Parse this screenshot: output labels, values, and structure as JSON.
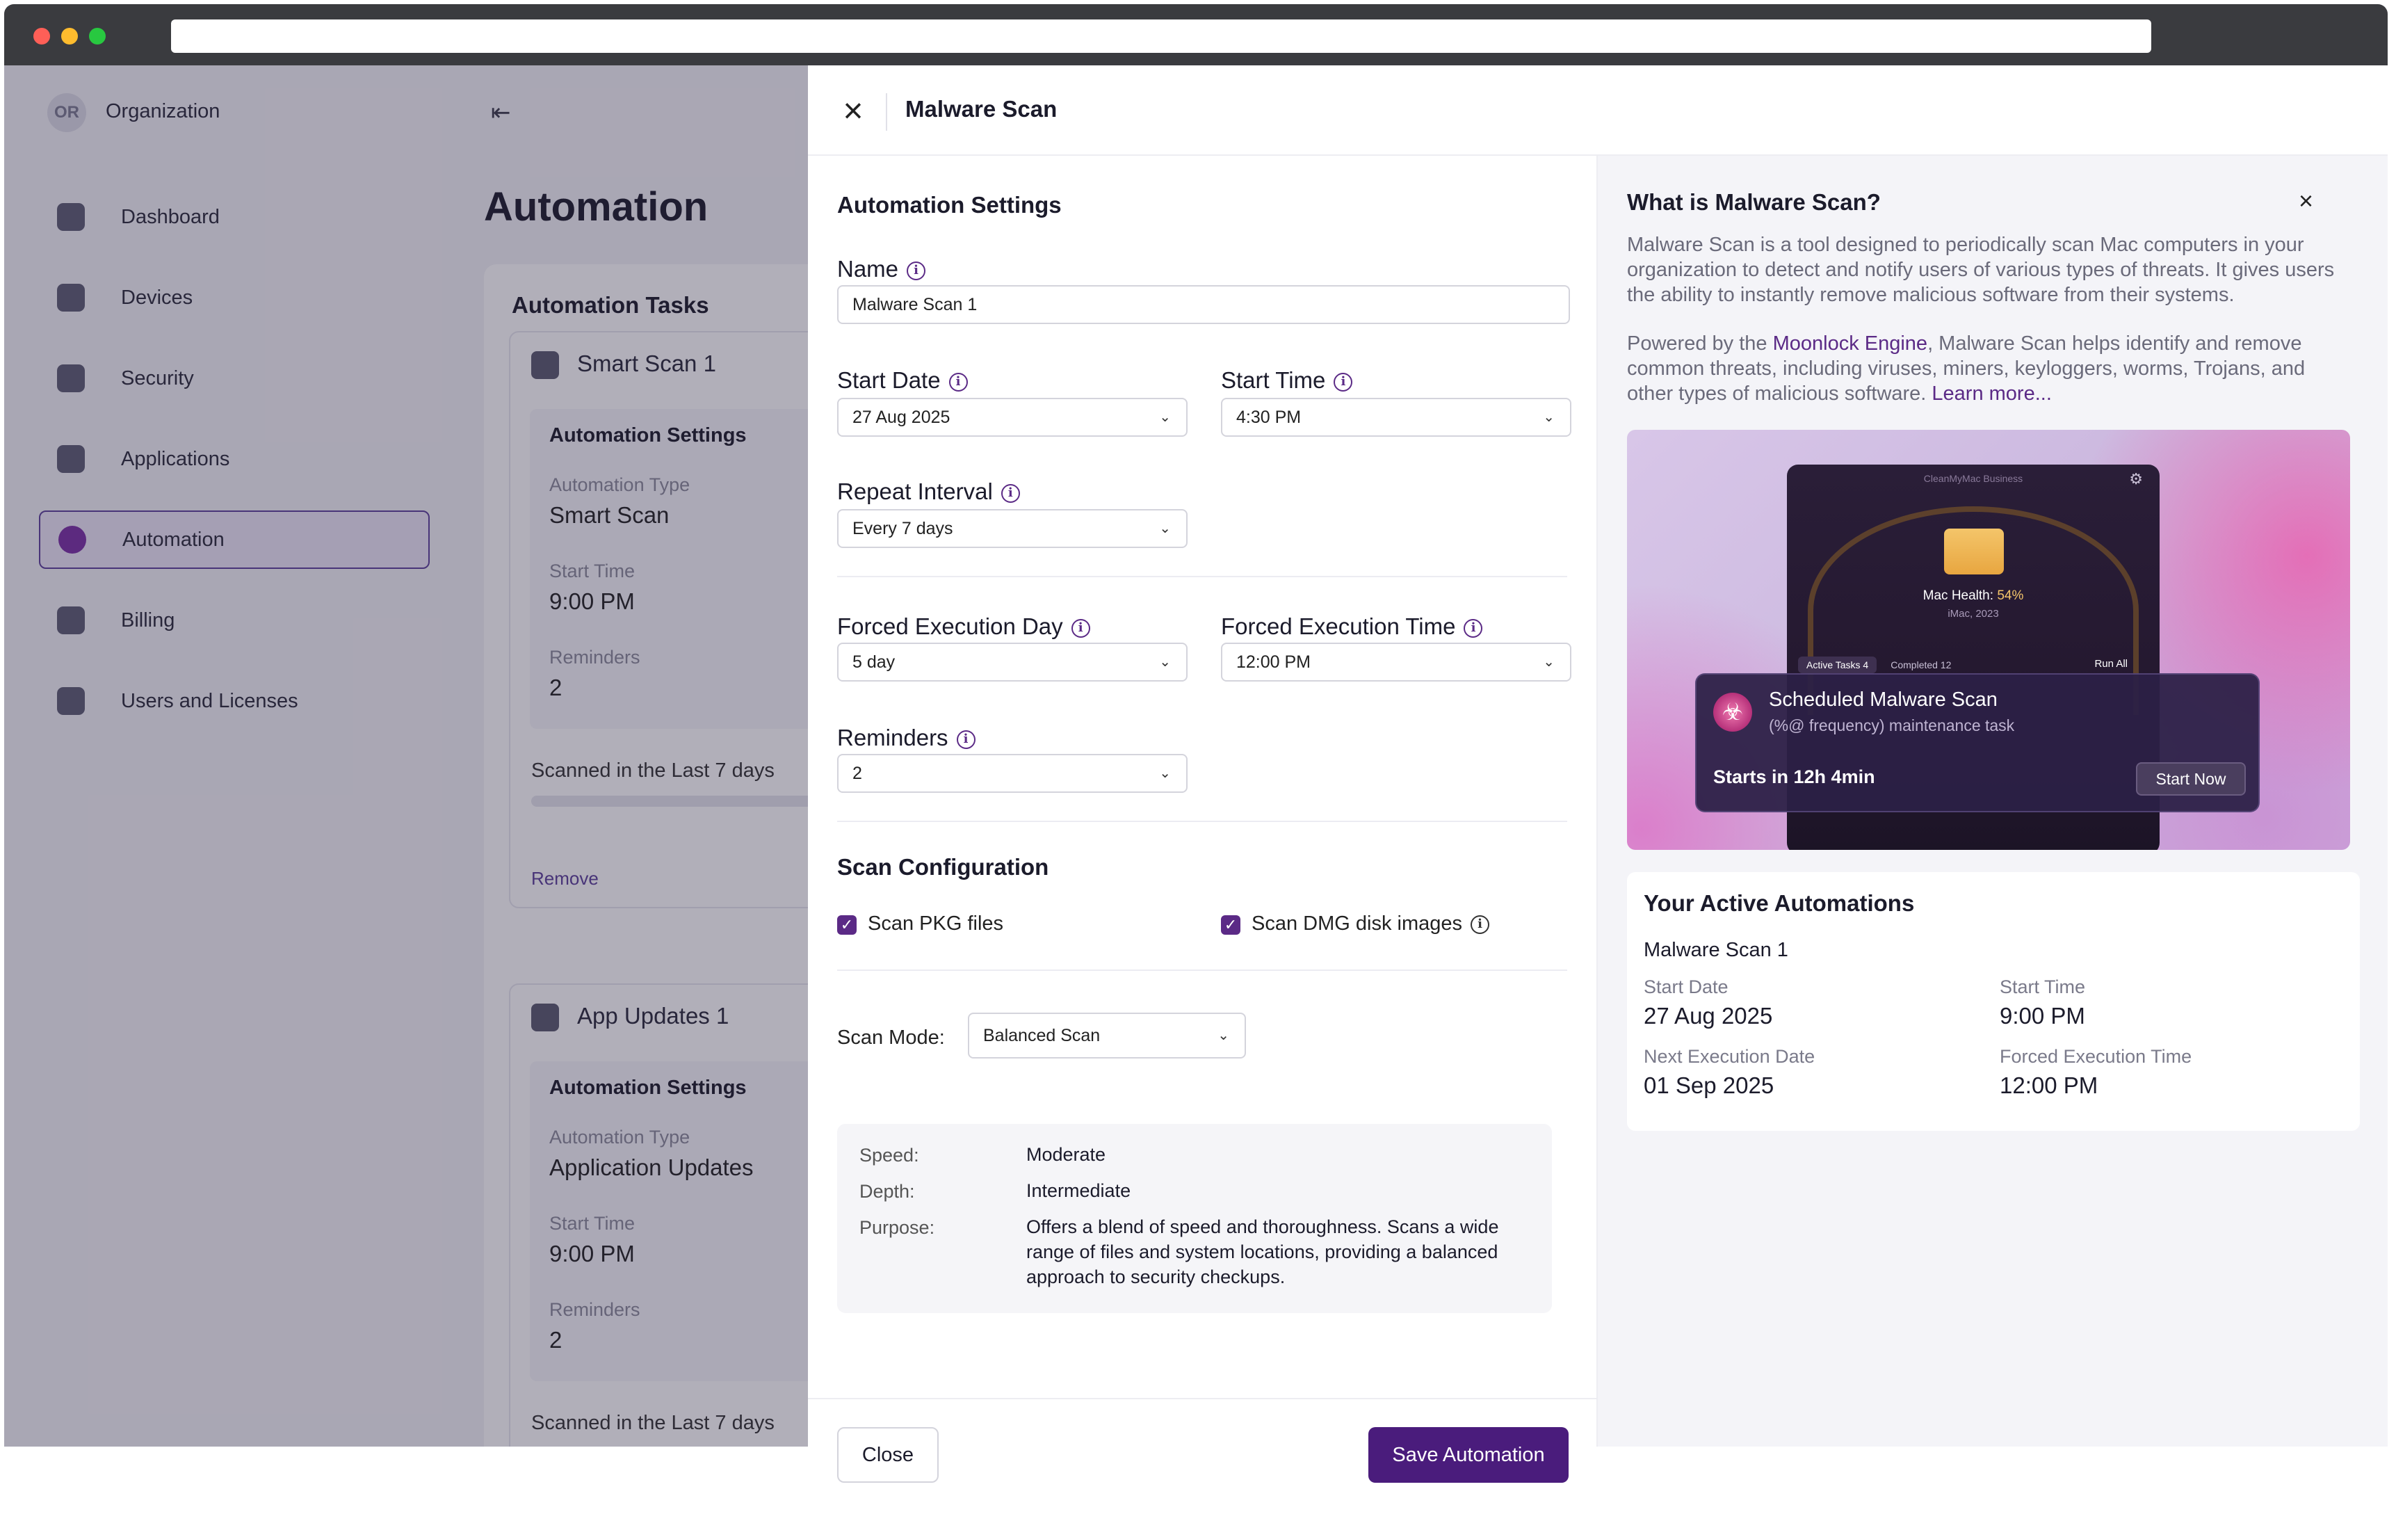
{
  "org": {
    "initials": "OR",
    "name": "Organization"
  },
  "sidebar": {
    "items": [
      {
        "label": "Dashboard"
      },
      {
        "label": "Devices"
      },
      {
        "label": "Security"
      },
      {
        "label": "Applications"
      },
      {
        "label": "Automation",
        "active": true
      },
      {
        "label": "Billing"
      },
      {
        "label": "Users and Licenses"
      }
    ]
  },
  "page": {
    "title": "Automation"
  },
  "tasks": {
    "title": "Automation Tasks",
    "cards": [
      {
        "name": "Smart Scan 1",
        "settings_title": "Automation Settings",
        "type_label": "Automation Type",
        "type_value": "Smart Scan",
        "start_label": "Start Time",
        "start_value": "9:00 PM",
        "reminders_label": "Reminders",
        "reminders_value": "2",
        "scanned": "Scanned in the Last 7 days",
        "remove": "Remove"
      },
      {
        "name": "App Updates 1",
        "settings_title": "Automation Settings",
        "type_label": "Automation Type",
        "type_value": "Application Updates",
        "start_label": "Start Time",
        "start_value": "9:00 PM",
        "reminders_label": "Reminders",
        "reminders_value": "2",
        "scanned": "Scanned in the Last 7 days"
      }
    ]
  },
  "modal": {
    "title": "Malware Scan",
    "settings_title": "Automation Settings",
    "name_label": "Name",
    "name_value": "Malware Scan 1",
    "start_date_label": "Start Date",
    "start_date_value": "27 Aug 2025",
    "start_time_label": "Start Time",
    "start_time_value": "4:30 PM",
    "repeat_label": "Repeat Interval",
    "repeat_value": "Every 7 days",
    "forced_day_label": "Forced Execution Day",
    "forced_day_value": "5 day",
    "forced_time_label": "Forced Execution Time",
    "forced_time_value": "12:00 PM",
    "reminders_label": "Reminders",
    "reminders_value": "2",
    "scan_config_title": "Scan Configuration",
    "scan_pkg_label": "Scan PKG files",
    "scan_pkg_checked": true,
    "scan_dmg_label": "Scan DMG disk images",
    "scan_dmg_checked": true,
    "scan_mode_label": "Scan Mode:",
    "scan_mode_value": "Balanced Scan",
    "mode_details": {
      "speed_label": "Speed:",
      "speed_value": "Moderate",
      "depth_label": "Depth:",
      "depth_value": "Intermediate",
      "purpose_label": "Purpose:",
      "purpose_value": "Offers a blend of speed and thoroughness. Scans a wide range of files and system locations, providing a balanced approach to security checkups."
    },
    "close_button": "Close",
    "save_button": "Save Automation"
  },
  "side": {
    "title": "What is Malware Scan?",
    "para1": "Malware Scan is a tool designed to periodically scan Mac computers in your organization to detect and notify users of various types of threats. It gives users the ability to instantly remove malicious software from their systems.",
    "para2_prefix": "Powered by the ",
    "para2_link": "Moonlock Engine",
    "para2_suffix": ", Malware Scan helps identify and remove common threats, including viruses, miners, keyloggers, worms, Trojans, and other types of malicious software. ",
    "learn_more": "Learn more...",
    "preview": {
      "app_name": "CleanMyMac Business",
      "health_label": "Mac Health: ",
      "health_value": "54%",
      "model": "iMac, 2023",
      "active_tasks": "Active Tasks 4",
      "completed": "Completed 12",
      "run_all": "Run All",
      "notif_title": "Scheduled Malware Scan",
      "notif_sub": "(%@ frequency) maintenance task",
      "notif_starts": "Starts in 12h 4min",
      "notif_button": "Start Now"
    },
    "active": {
      "title": "Your Active Automations",
      "name": "Malware Scan 1",
      "start_date_label": "Start Date",
      "start_date_value": "27 Aug 2025",
      "start_time_label": "Start Time",
      "start_time_value": "9:00 PM",
      "next_label": "Next Execution Date",
      "next_value": "01 Sep 2025",
      "forced_label": "Forced Execution Time",
      "forced_value": "12:00 PM"
    }
  },
  "icons": {
    "close": "close-icon",
    "info": "info-icon",
    "chevron": "chevron-down-icon",
    "check": "checkmark-icon",
    "collapse": "collapse-sidebar-icon"
  },
  "colors": {
    "accent": "#5b2a86",
    "save_button": "#4a1c7c",
    "link": "#5b2a86"
  }
}
